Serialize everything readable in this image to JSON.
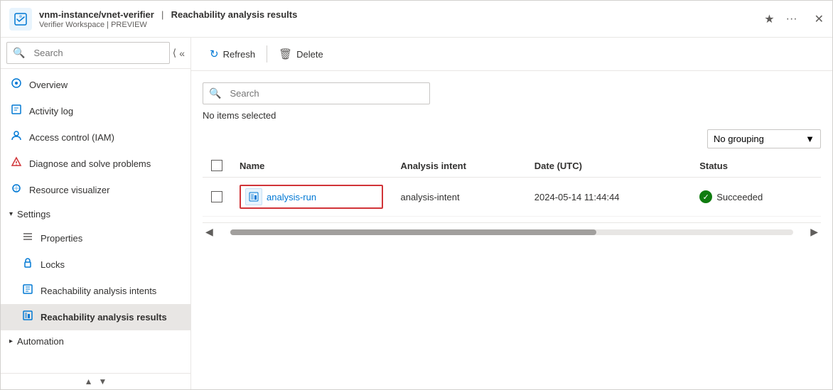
{
  "titleBar": {
    "resourcePath": "vnm-instance/vnet-verifier",
    "separator": "|",
    "pageTitle": "Reachability analysis results",
    "subtitle": "Verifier Workspace | PREVIEW",
    "starIcon": "★",
    "moreIcon": "···",
    "closeIcon": "✕"
  },
  "sidebar": {
    "searchPlaceholder": "Search",
    "collapseIcon": "«",
    "expandIcon": "›",
    "navItems": [
      {
        "id": "overview",
        "label": "Overview",
        "icon": "⊙"
      },
      {
        "id": "activity-log",
        "label": "Activity log",
        "icon": "📋"
      },
      {
        "id": "access-control",
        "label": "Access control (IAM)",
        "icon": "👤"
      },
      {
        "id": "diagnose",
        "label": "Diagnose and solve problems",
        "icon": "🔧"
      },
      {
        "id": "resource-visualizer",
        "label": "Resource visualizer",
        "icon": "🌐"
      }
    ],
    "sections": [
      {
        "id": "settings",
        "label": "Settings",
        "expanded": true,
        "items": [
          {
            "id": "properties",
            "label": "Properties",
            "icon": "≡"
          },
          {
            "id": "locks",
            "label": "Locks",
            "icon": "🔒"
          },
          {
            "id": "reachability-intents",
            "label": "Reachability analysis intents",
            "icon": "📄"
          },
          {
            "id": "reachability-results",
            "label": "Reachability analysis results",
            "icon": "📊",
            "active": true
          }
        ]
      },
      {
        "id": "automation",
        "label": "Automation",
        "expanded": false,
        "items": []
      }
    ],
    "scrollUpIcon": "▲",
    "scrollDownIcon": "▼"
  },
  "toolbar": {
    "refreshLabel": "Refresh",
    "refreshIcon": "↻",
    "deleteLabel": "Delete",
    "deleteIcon": "🗑"
  },
  "content": {
    "searchPlaceholder": "Search",
    "searchIcon": "🔍",
    "noItemsText": "No items selected",
    "groupingLabel": "No grouping",
    "groupingChevron": "▼",
    "table": {
      "columns": [
        {
          "id": "checkbox",
          "label": ""
        },
        {
          "id": "name",
          "label": "Name"
        },
        {
          "id": "analysis-intent",
          "label": "Analysis intent"
        },
        {
          "id": "date",
          "label": "Date (UTC)"
        },
        {
          "id": "status",
          "label": "Status"
        }
      ],
      "rows": [
        {
          "id": "row-1",
          "name": "analysis-run",
          "analysisIntent": "analysis-intent",
          "date": "2024-05-14 11:44:44",
          "status": "Succeeded",
          "statusType": "success"
        }
      ]
    }
  }
}
